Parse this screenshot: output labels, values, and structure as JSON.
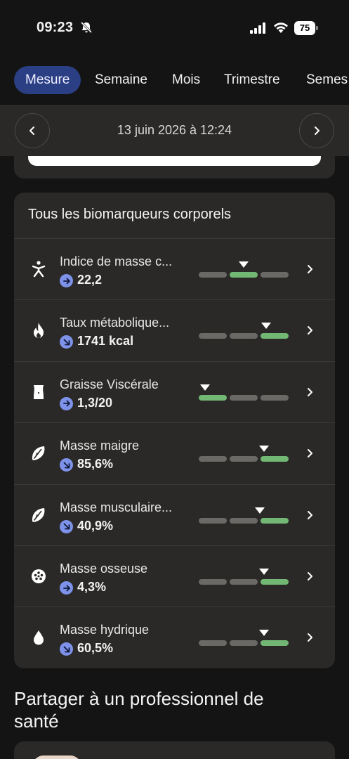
{
  "status_bar": {
    "time": "09:23",
    "battery": "75"
  },
  "tabs": [
    {
      "label": "Mesure",
      "active": true
    },
    {
      "label": "Semaine",
      "active": false
    },
    {
      "label": "Mois",
      "active": false
    },
    {
      "label": "Trimestre",
      "active": false
    },
    {
      "label": "Semes",
      "active": false
    }
  ],
  "date_nav": {
    "date": "13 juin 2026 à 12:24"
  },
  "biomarkers": {
    "title": "Tous les biomarqueurs corporels",
    "items": [
      {
        "name": "Indice de masse c...",
        "value": "22,2",
        "trend": "right",
        "icon": "person-icon",
        "level": 0.5,
        "active_segment": 1
      },
      {
        "name": "Taux métabolique...",
        "value": "1741 kcal",
        "trend": "down-right",
        "icon": "flame-icon",
        "level": 0.75,
        "active_segment": 2
      },
      {
        "name": "Graisse Viscérale",
        "value": "1,3/20",
        "trend": "right",
        "icon": "torso-icon",
        "level": 0.07,
        "active_segment": 0
      },
      {
        "name": "Masse maigre",
        "value": "85,6%",
        "trend": "down-right",
        "icon": "leaf-icon",
        "level": 0.73,
        "active_segment": 2
      },
      {
        "name": "Masse musculaire...",
        "value": "40,9%",
        "trend": "down-right",
        "icon": "leaf-icon",
        "level": 0.68,
        "active_segment": 2
      },
      {
        "name": "Masse osseuse",
        "value": "4,3%",
        "trend": "right",
        "icon": "bone-icon",
        "level": 0.73,
        "active_segment": 2
      },
      {
        "name": "Masse hydrique",
        "value": "60,5%",
        "trend": "down-right",
        "icon": "drop-icon",
        "level": 0.73,
        "active_segment": 2
      }
    ]
  },
  "share": {
    "title": "Partager à un professionnel de santé"
  },
  "colors": {
    "background": "#141414",
    "card": "#2a2927",
    "accent_tab": "#2b3f85",
    "trend_badge": "#7d92e8",
    "scale_active": "#72b874",
    "scale_inactive": "#6a6966"
  }
}
